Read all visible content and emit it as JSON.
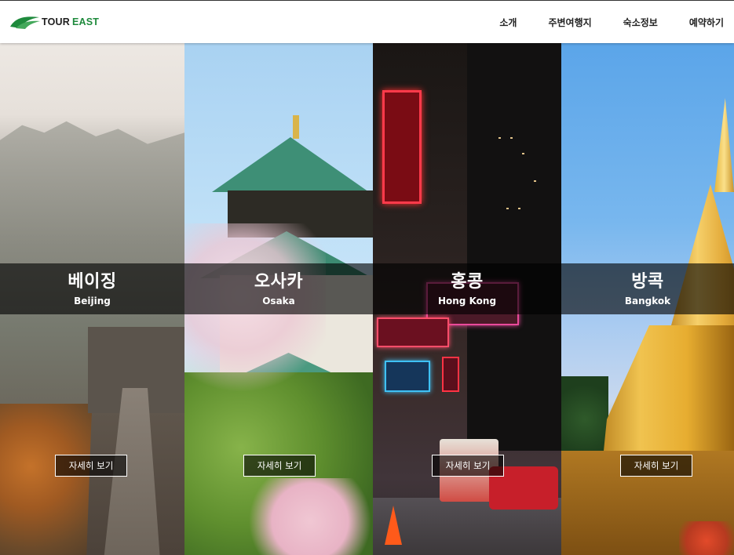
{
  "header": {
    "logo": {
      "tour": "TOUR",
      "east": "EAST",
      "icon": "tour-east-wave-logo"
    },
    "nav": [
      {
        "label": "소개"
      },
      {
        "label": "주변여행지"
      },
      {
        "label": "숙소정보"
      },
      {
        "label": "예약하기"
      }
    ]
  },
  "destinations": [
    {
      "name_ko": "베이징",
      "name_en": "Beijing",
      "button": "자세히 보기"
    },
    {
      "name_ko": "오사카",
      "name_en": "Osaka",
      "button": "자세히 보기"
    },
    {
      "name_ko": "홍콩",
      "name_en": "Hong Kong",
      "button": "자세히 보기"
    },
    {
      "name_ko": "방콕",
      "name_en": "Bangkok",
      "button": "자세히 보기"
    }
  ],
  "colors": {
    "brand_green": "#1e8a3c",
    "band_bg": "rgba(0,0,0,0.62)"
  }
}
